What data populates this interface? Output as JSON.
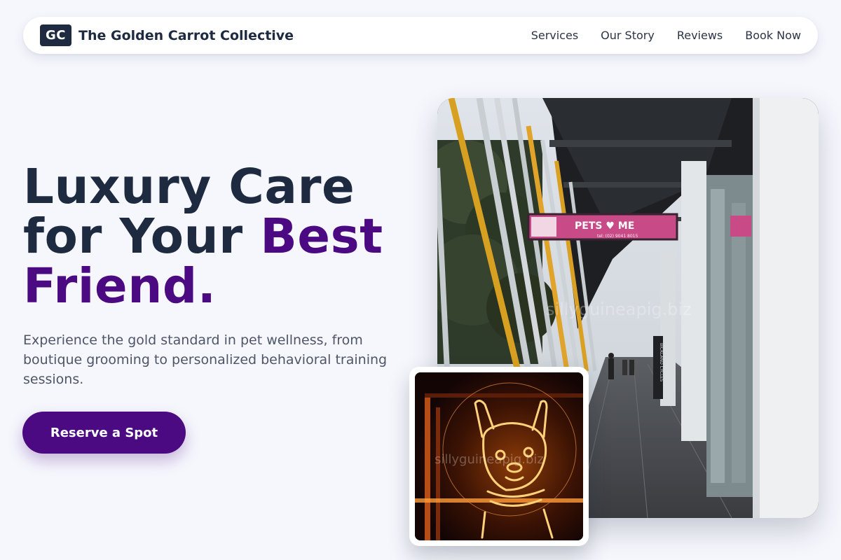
{
  "brand": {
    "logo_text": "GC",
    "name": "The Golden Carrot Collective"
  },
  "nav": {
    "links": [
      "Services",
      "Our Story",
      "Reviews",
      "Book Now"
    ]
  },
  "hero": {
    "title_line1": "Luxury Care",
    "title_line2_plain": "for Your ",
    "title_line2_accent": "Best",
    "title_line3_accent": "Friend.",
    "subtitle": "Experience the gold standard in pet wellness, from boutique grooming to personalized behavioral training sessions.",
    "cta_label": "Reserve a Spot"
  },
  "photos": {
    "main_watermark": "sillyguineapig.biz",
    "main_sign_text": "PETS ♥ ME",
    "main_sign_phone": "tel: (02) 9041 8015",
    "main_side_sign": "BICKLAND CYCLES",
    "inset_watermark": "sillyguineapig.biz"
  },
  "colors": {
    "accent": "#4c0a82",
    "dark": "#1e2a40",
    "background": "#f6f7fd"
  }
}
